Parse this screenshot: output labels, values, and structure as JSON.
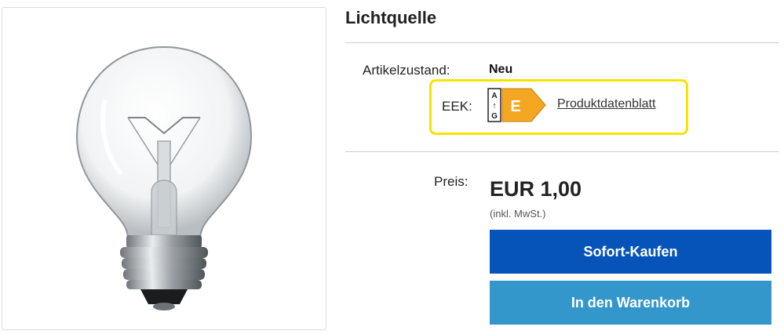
{
  "product": {
    "title": "Lichtquelle",
    "image_alt": "Glühbirne"
  },
  "details": {
    "condition_label": "Artikelzustand:",
    "condition_value": "Neu",
    "eek_label": "EEK:",
    "energy_class": "E",
    "energy_scale_top": "A",
    "energy_scale_bottom": "G",
    "energy_scale_arrow": "↑",
    "datasheet_link": "Produktdatenblatt"
  },
  "pricing": {
    "price_label": "Preis:",
    "price": "EUR 1,00",
    "price_note": "(inkl. MwSt.)"
  },
  "actions": {
    "buy_now": "Sofort-Kaufen",
    "add_to_cart": "In den Warenkorb"
  },
  "colors": {
    "energy_class_color": "#f5a623",
    "highlight_border": "#f5e400",
    "buy_button": "#0654ba",
    "cart_button": "#3497cb"
  }
}
